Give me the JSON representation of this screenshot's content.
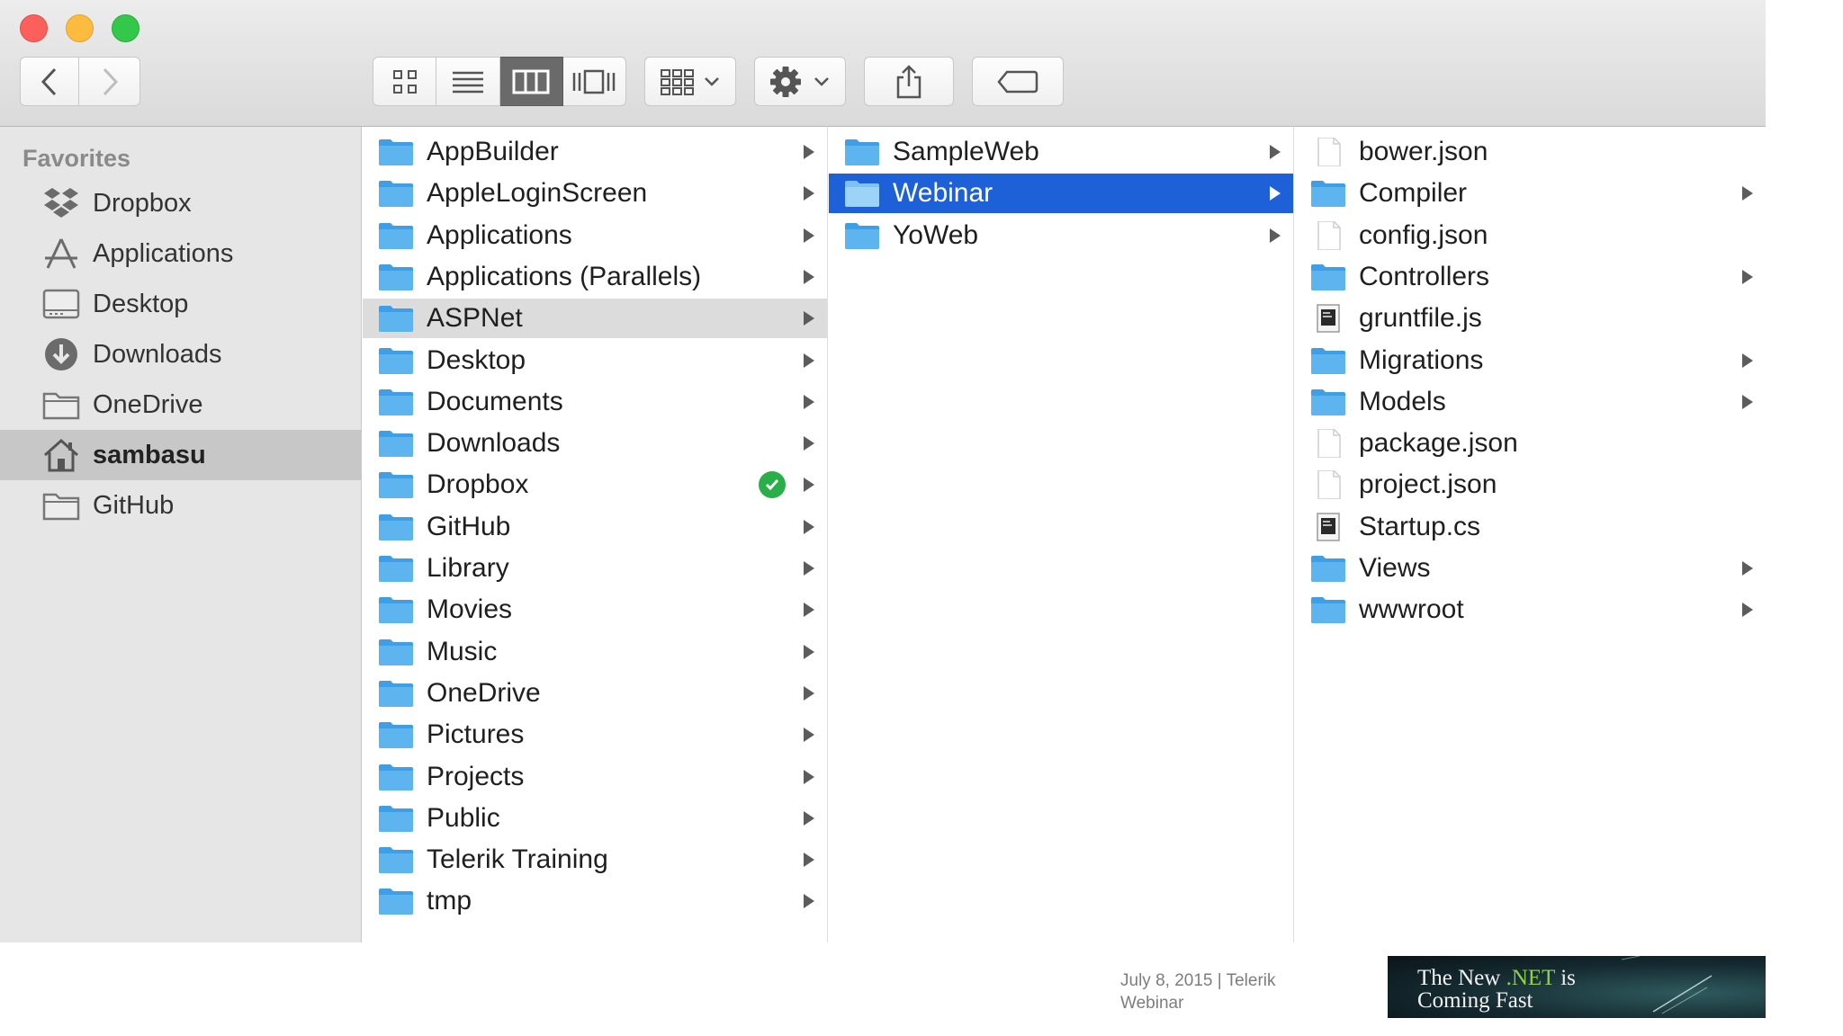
{
  "sidebar": {
    "heading": "Favorites",
    "items": [
      {
        "label": "Dropbox",
        "icon": "dropbox-icon"
      },
      {
        "label": "Applications",
        "icon": "applications-icon"
      },
      {
        "label": "Desktop",
        "icon": "desktop-icon"
      },
      {
        "label": "Downloads",
        "icon": "downloads-icon"
      },
      {
        "label": "OneDrive",
        "icon": "folder-icon"
      },
      {
        "label": "sambasu",
        "icon": "home-icon",
        "selected": true
      },
      {
        "label": "GitHub",
        "icon": "folder-icon"
      }
    ]
  },
  "columns": {
    "col1": [
      {
        "label": "AppBuilder"
      },
      {
        "label": "AppleLoginScreen"
      },
      {
        "label": "Applications"
      },
      {
        "label": "Applications (Parallels)"
      },
      {
        "label": "ASPNet",
        "highlight": "gray"
      },
      {
        "label": "Desktop"
      },
      {
        "label": "Documents"
      },
      {
        "label": "Downloads"
      },
      {
        "label": "Dropbox",
        "status": "synced-check"
      },
      {
        "label": "GitHub"
      },
      {
        "label": "Library"
      },
      {
        "label": "Movies"
      },
      {
        "label": "Music"
      },
      {
        "label": "OneDrive"
      },
      {
        "label": "Pictures"
      },
      {
        "label": "Projects"
      },
      {
        "label": "Public"
      },
      {
        "label": "Telerik Training"
      },
      {
        "label": "tmp"
      }
    ],
    "col2": [
      {
        "label": "SampleWeb"
      },
      {
        "label": "Webinar",
        "highlight": "blue"
      },
      {
        "label": "YoWeb"
      }
    ],
    "col3": [
      {
        "label": "bower.json",
        "kind": "file"
      },
      {
        "label": "Compiler",
        "kind": "folder"
      },
      {
        "label": "config.json",
        "kind": "file"
      },
      {
        "label": "Controllers",
        "kind": "folder"
      },
      {
        "label": "gruntfile.js",
        "kind": "script"
      },
      {
        "label": "Migrations",
        "kind": "folder"
      },
      {
        "label": "Models",
        "kind": "folder"
      },
      {
        "label": "package.json",
        "kind": "file"
      },
      {
        "label": "project.json",
        "kind": "file"
      },
      {
        "label": "Startup.cs",
        "kind": "script"
      },
      {
        "label": "Views",
        "kind": "folder"
      },
      {
        "label": "wwwroot",
        "kind": "folder"
      }
    ]
  },
  "toolbar": {
    "view_modes": [
      "icon-view-icon",
      "list-view-icon",
      "column-view-icon",
      "cover-flow-icon"
    ],
    "active_view": "column-view-icon"
  },
  "footer": {
    "date_line": "July 8, 2015  |  Telerik",
    "event_line": "Webinar",
    "banner_line1_pre": "The New ",
    "banner_line1_net": ".NET",
    "banner_line1_post": " is",
    "banner_line2": "Coming Fast"
  },
  "colors": {
    "selection_blue": "#1d60d8",
    "folder_blue": "#5eb4ef",
    "check_green": "#2aae48"
  }
}
